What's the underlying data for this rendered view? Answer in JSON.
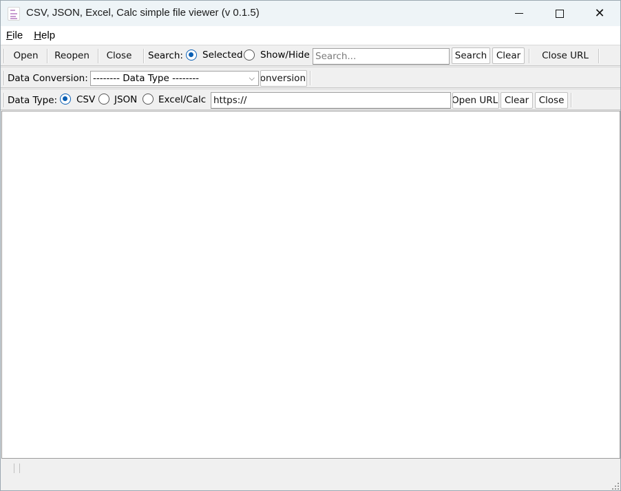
{
  "window": {
    "title": "CSV, JSON, Excel, Calc simple file viewer (v 0.1.5)",
    "close_glyph": "✕"
  },
  "menu": {
    "file_accel": "F",
    "file_rest": "ile",
    "help_accel": "H",
    "help_rest": "elp"
  },
  "toolbar1": {
    "open": "Open",
    "reopen": "Reopen",
    "close": "Close",
    "search_label": "Search:",
    "radio_selected": "Selected",
    "radio_show_hide": "Show/Hide",
    "search_placeholder": "Search...",
    "search_button": "Search",
    "clear_button": "Clear",
    "close_url": "Close URL"
  },
  "toolbar2": {
    "label": "Data Conversion:",
    "select_value": "--------  Data Type  --------",
    "conversion_button": "Conversion"
  },
  "toolbar3": {
    "label": "Data Type:",
    "csv": "CSV",
    "json": "JSON",
    "excel_calc": "Excel/Calc",
    "url_value": "https://",
    "open_url": "Open URL",
    "clear": "Clear",
    "close": "Close"
  },
  "icons": {
    "chevron": "⌵"
  },
  "colors": {
    "accent": "#0a5fb4",
    "titlebar": "#eef4f7"
  }
}
